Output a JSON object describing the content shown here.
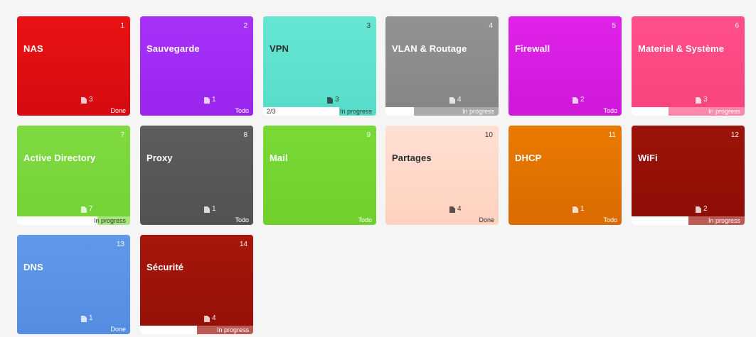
{
  "cards": [
    {
      "num": "1",
      "title": "NAS",
      "docs": "3",
      "status": "Done"
    },
    {
      "num": "2",
      "title": "Sauvegarde",
      "docs": "1",
      "status": "Todo"
    },
    {
      "num": "3",
      "title": "VPN",
      "docs": "3",
      "status": "In progress",
      "progress_count": "2/3",
      "progress_fraction": 0.67
    },
    {
      "num": "4",
      "title": "VLAN & Routage",
      "docs": "4",
      "status": "In progress",
      "progress_fraction": 0.75
    },
    {
      "num": "5",
      "title": "Firewall",
      "docs": "2",
      "status": "Todo"
    },
    {
      "num": "6",
      "title": "Materiel & Système",
      "docs": "3",
      "status": "In progress",
      "progress_fraction": 0.67
    },
    {
      "num": "7",
      "title": "Active Directory",
      "docs": "7",
      "status": "In progress",
      "progress_fraction": 0.29
    },
    {
      "num": "8",
      "title": "Proxy",
      "docs": "1",
      "status": "Todo"
    },
    {
      "num": "9",
      "title": "Mail",
      "docs": "",
      "status": "Todo"
    },
    {
      "num": "10",
      "title": "Partages",
      "docs": "4",
      "status": "Done"
    },
    {
      "num": "11",
      "title": "DHCP",
      "docs": "1",
      "status": "Todo"
    },
    {
      "num": "12",
      "title": "WiFi",
      "docs": "2",
      "status": "In progress",
      "progress_fraction": 0.5
    },
    {
      "num": "13",
      "title": "DNS",
      "docs": "1",
      "status": "Done"
    },
    {
      "num": "14",
      "title": "Sécurité",
      "docs": "4",
      "status": "In progress",
      "progress_fraction": 0.5
    }
  ],
  "colors": {
    "nas": "#e60f12",
    "sauvegarde": "#a22cf5",
    "vpn": "#5fe3d0",
    "vlan": "#8c8c8c",
    "firewall": "#d91fe3",
    "materiel": "#ff4d87",
    "active_directory": "#7ad83a",
    "proxy": "#5a5a5a",
    "mail": "#76d633",
    "partages": "#ffd7c7",
    "dhcp": "#e37300",
    "wifi": "#951007",
    "dns": "#5b93e6",
    "securite": "#a1140a"
  }
}
